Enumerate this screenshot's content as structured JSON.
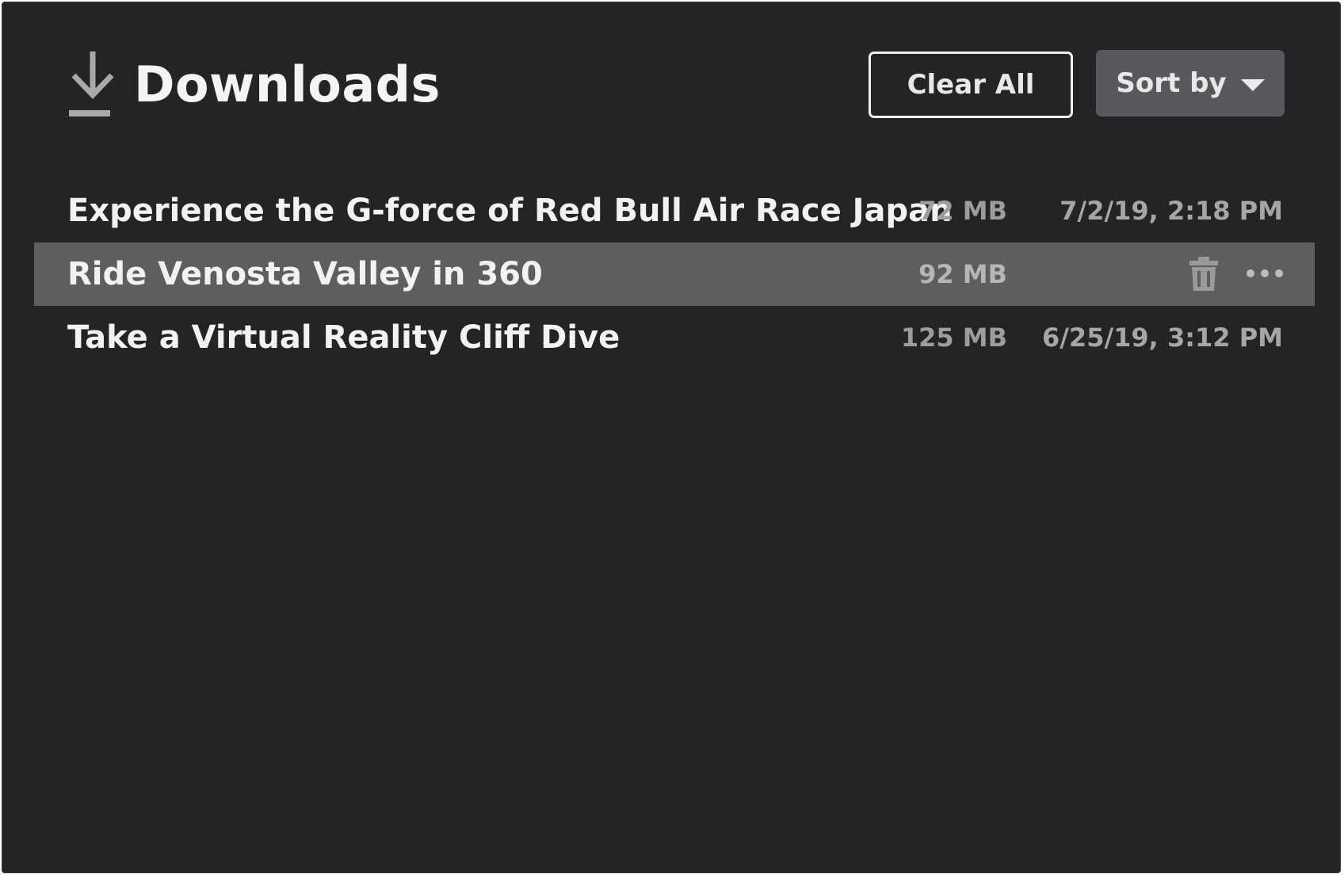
{
  "header": {
    "title": "Downloads",
    "icon": "download-icon",
    "clear_all_label": "Clear All",
    "sort_label": "Sort by"
  },
  "downloads": [
    {
      "name": "Experience the G-force of Red Bull Air Race Japan",
      "size": "72 MB",
      "date": "7/2/19, 2:18 PM",
      "selected": false
    },
    {
      "name": "Ride Venosta Valley in 360",
      "size": "92 MB",
      "date": "",
      "selected": true,
      "actions": [
        "trash-icon",
        "more-options-icon"
      ]
    },
    {
      "name": "Take a Virtual Reality Cliff Dive",
      "size": "125 MB",
      "date": "6/25/19, 3:12 PM",
      "selected": false
    }
  ],
  "colors": {
    "background": "#232426",
    "selected_row": "#5d5e60",
    "sort_button": "#58595c",
    "text": "#f2f2f2",
    "muted_text": "#9d9d9f"
  }
}
